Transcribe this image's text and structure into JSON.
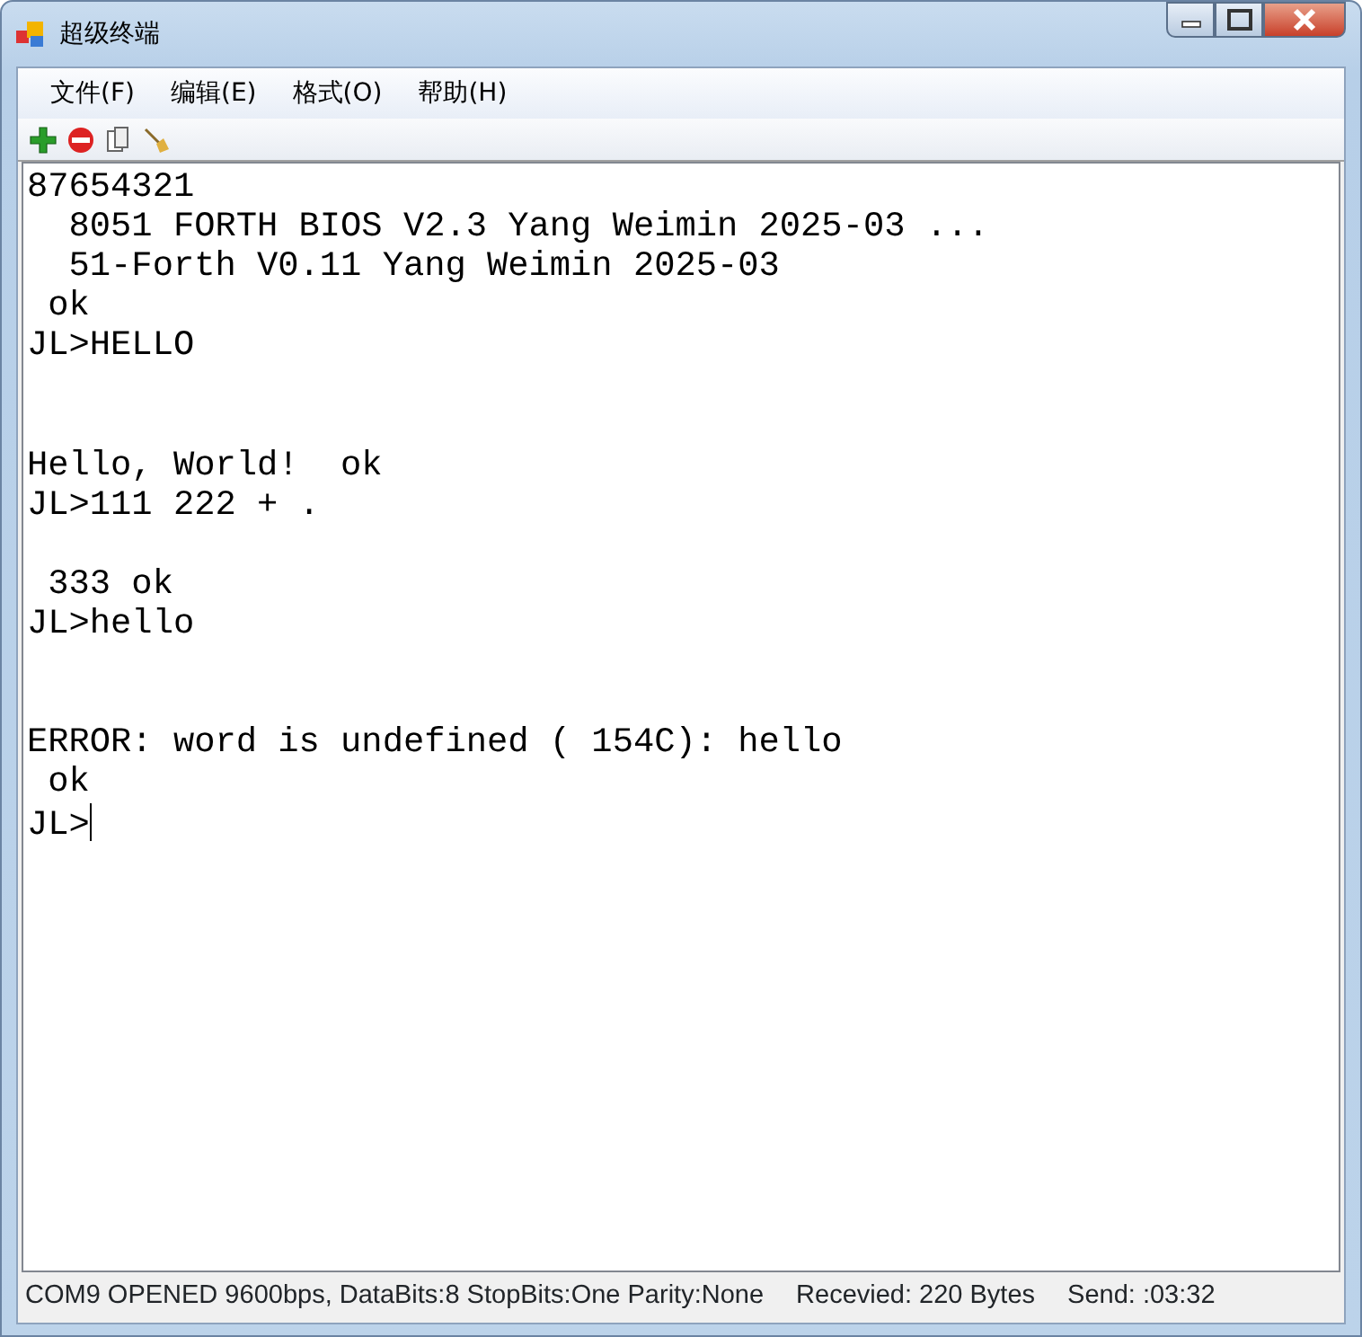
{
  "window": {
    "title": "超级终端"
  },
  "menu": [
    "文件(F)",
    "编辑(E)",
    "格式(O)",
    "帮助(H)"
  ],
  "toolbar": [
    {
      "kind": "add"
    },
    {
      "kind": "remove"
    },
    {
      "kind": "copy"
    },
    {
      "kind": "clear"
    }
  ],
  "terminal": {
    "output": "87654321\n  8051 FORTH BIOS V2.3 Yang Weimin 2025-03 ...\n  51-Forth V0.11 Yang Weimin 2025-03\n ok\nJL>HELLO\n\n\nHello, World!  ok\nJL>111 222 + .\n\n 333 ok\nJL>hello\n\n\nERROR: word is undefined ( 154C): hello\n ok\nJL>"
  },
  "status_bar": [
    "COM9 OPENED 9600bps, DataBits:8 StopBits:One Parity:None",
    "Recevied: 220 Bytes",
    "Send: :03:32"
  ]
}
